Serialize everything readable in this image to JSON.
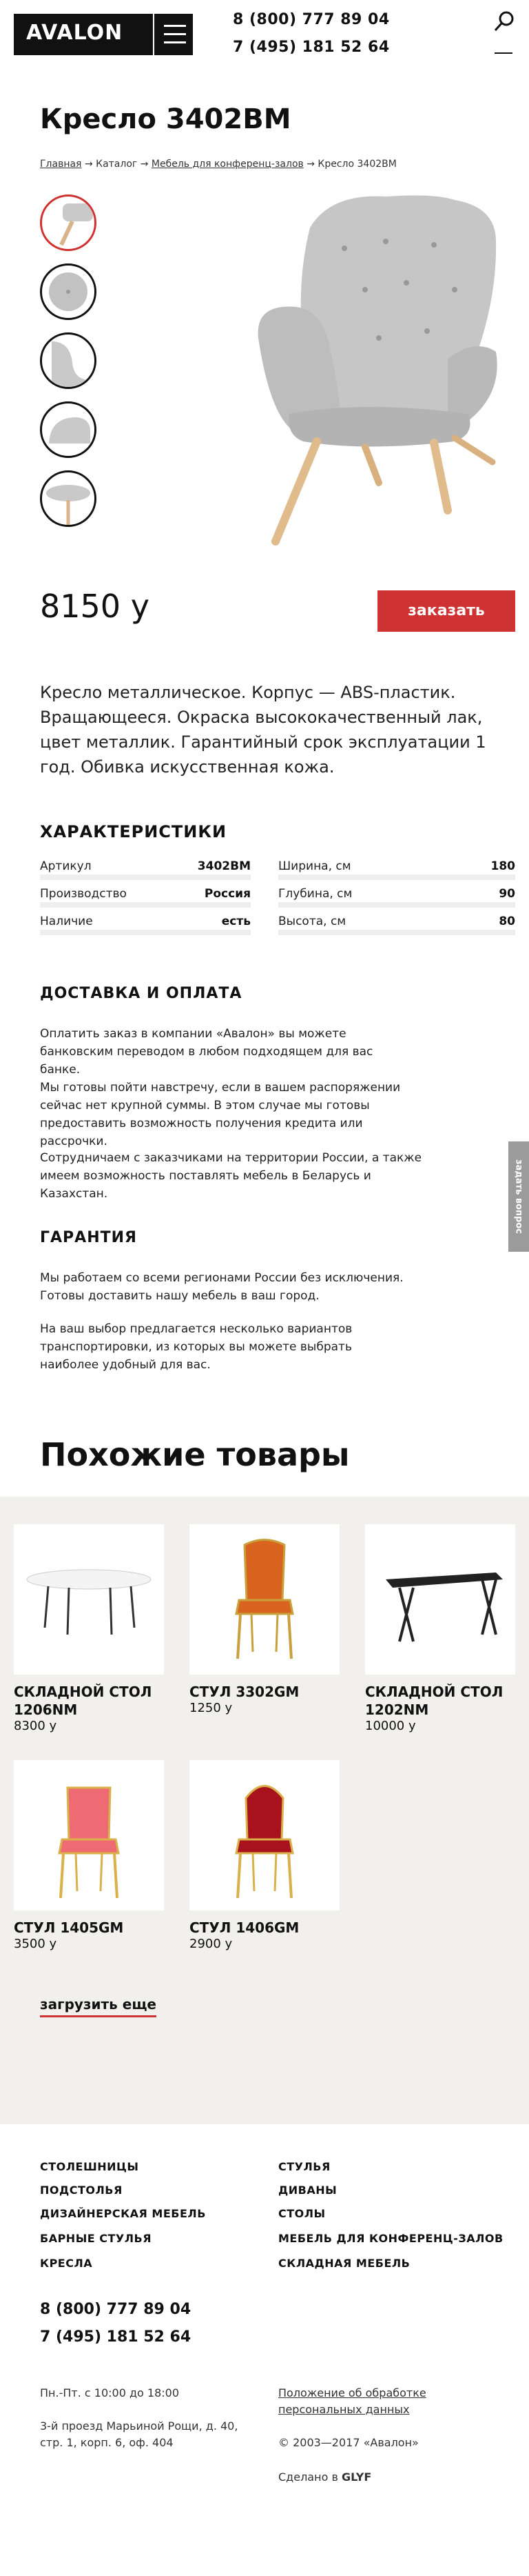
{
  "header": {
    "logo": "AVALON",
    "phone1": "8 (800) 777 89 04",
    "phone2": "7 (495) 181 52 64"
  },
  "product": {
    "title": "Кресло 3402BM",
    "breadcrumbs": [
      "Главная",
      "Каталог",
      "Мебель для конференц-залов",
      "Кресло 3402BM"
    ],
    "price": "8150 у",
    "order_label": "заказать",
    "description": "Кресло металлическое. Корпус — ABS-пластик. Вращающееся. Окраска высококачественный лак, цвет металлик. Гарантийный срок эксплуатации 1 год. Обивка искусственная кожа."
  },
  "specs": {
    "title": "ХАРАКТЕРИСТИКИ",
    "left": [
      {
        "label": "Артикул",
        "value": "3402BM"
      },
      {
        "label": "Производство",
        "value": "Россия"
      },
      {
        "label": "Наличие",
        "value": "есть"
      }
    ],
    "right": [
      {
        "label": "Ширина, см",
        "value": "180"
      },
      {
        "label": "Глубина, см",
        "value": "90"
      },
      {
        "label": "Высота, см",
        "value": "80"
      }
    ]
  },
  "delivery": {
    "title": "ДОСТАВКА И ОПЛАТА",
    "p1": "Оплатить заказ в компании «Авалон» вы можете банковским переводом в любом подходящем для вас банке.",
    "p2": "Мы готовы пойти навстречу, если в вашем распоряжении сейчас нет крупной суммы. В этом случае мы готовы предоставить возможность получения кредита или рассрочки.",
    "p3": "Сотрудничаем с заказчиками на территории России, а также имеем возможность поставлять мебель в Беларусь и Казахстан."
  },
  "warranty": {
    "title": "ГАРАНТИЯ",
    "p1": "Мы работаем со всеми регионами России без исключения. Готовы доставить нашу мебель в ваш город.",
    "p2": "На ваш выбор предлагается несколько вариантов транспортировки, из которых вы можете выбрать наиболее удобный для вас."
  },
  "similar": {
    "title": "Похожие товары",
    "items": [
      {
        "name": "СКЛАДНОЙ СТОЛ 1206NM",
        "price": "8300 у"
      },
      {
        "name": "СТУЛ 3302GM",
        "price": "1250 у"
      },
      {
        "name": "СКЛАДНОЙ СТОЛ 1202NM",
        "price": "10000 у"
      },
      {
        "name": "СТУЛ 1405GM",
        "price": "3500 у"
      },
      {
        "name": "СТУЛ 1406GM",
        "price": "2900 у"
      }
    ],
    "more_label": "загрузить еще"
  },
  "ask_label": "задать вопрос",
  "footer": {
    "links_left": [
      "СТОЛЕШНИЦЫ",
      "ПОДСТОЛЬЯ",
      "ДИЗАЙНЕРСКАЯ МЕБЕЛЬ",
      "БАРНЫЕ СТУЛЬЯ",
      "КРЕСЛА"
    ],
    "links_right": [
      "СТУЛЬЯ",
      "ДИВАНЫ",
      "СТОЛЫ",
      "МЕБЕЛЬ ДЛЯ КОНФЕРЕНЦ-ЗАЛОВ",
      "СКЛАДНАЯ МЕБЕЛЬ"
    ],
    "phone1": "8 (800) 777 89 04",
    "phone2": "7 (495) 181 52 64",
    "hours": "Пн.-Пт. с 10:00 до 18:00",
    "address": "3-й проезд Марьиной Рощи, д. 40, стр. 1, корп. 6, оф. 404",
    "privacy": "Положение об обработке персональных данных",
    "copyright": "© 2003—2017 «Авалон»",
    "made_by": "Сделано в",
    "made_by_brand": "GLYF"
  },
  "colors": {
    "accent": "#cf3232",
    "gray_bg": "#f1f0ed"
  }
}
